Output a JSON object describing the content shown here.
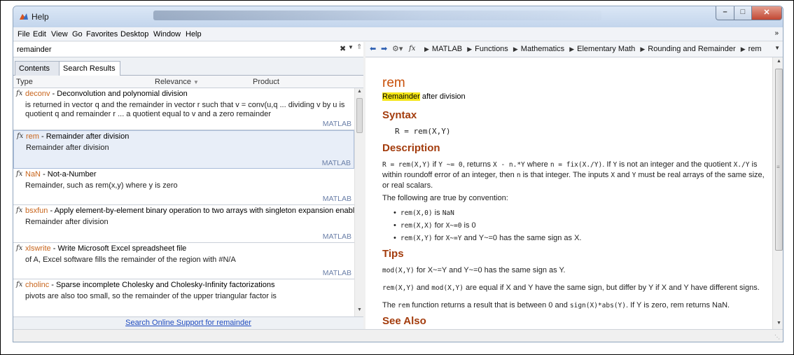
{
  "window": {
    "title": "Help"
  },
  "menu": [
    "File",
    "Edit",
    "View",
    "Go",
    "Favorites",
    "Desktop",
    "Window",
    "Help"
  ],
  "search": {
    "value": "remainder"
  },
  "tabs": [
    "Contents",
    "Search Results"
  ],
  "columns": {
    "type": "Type",
    "relevance": "Relevance",
    "product": "Product"
  },
  "results": [
    {
      "name": "deconv",
      "desc": " - Deconvolution and polynomial division",
      "snippet": "is returned in vector q and the remainder in vector r such that v = conv(u,q ... dividing v by u is quotient q and remainder r ... a quotient equal to v and a zero remainder",
      "product": "MATLAB"
    },
    {
      "name": "rem",
      "desc": " - Remainder after division",
      "snippet": "Remainder after division",
      "product": "MATLAB"
    },
    {
      "name": "NaN",
      "desc": " - Not-a-Number",
      "snippet": "Remainder, such as rem(x,y) where y is zero",
      "product": "MATLAB"
    },
    {
      "name": "bsxfun",
      "desc": " - Apply element-by-element binary operation to two arrays with singleton expansion enabled",
      "snippet": "Remainder after division",
      "product": "MATLAB"
    },
    {
      "name": "xlswrite",
      "desc": " - Write Microsoft Excel spreadsheet file",
      "snippet": "of A, Excel software fills the remainder of the region with #N/A",
      "product": "MATLAB"
    },
    {
      "name": "cholinc",
      "desc": " - Sparse incomplete Cholesky and Cholesky-Infinity factorizations",
      "snippet": "pivots are also too small, so the remainder of the upper triangular factor is",
      "product": ""
    }
  ],
  "online_link": "Search Online Support for remainder",
  "breadcrumb": [
    "MATLAB",
    "Functions",
    "Mathematics",
    "Elementary Math",
    "Rounding and Remainder",
    "rem"
  ],
  "doc": {
    "fname": "rem",
    "purpose_hl": "Remainder",
    "purpose_rest": " after division",
    "syntax_heading": "Syntax",
    "syntax": "R = rem(X,Y)",
    "description_heading": "Description",
    "desc_code1": "R = rem(X,Y)",
    "desc_t1": " if ",
    "desc_code2": "Y ~= 0",
    "desc_t2": ", returns ",
    "desc_code3": "X - n.*Y",
    "desc_t3": " where ",
    "desc_code4": "n = fix(X./Y)",
    "desc_t4": ". If ",
    "desc_code5": "Y",
    "desc_t5": " is not an integer and the quotient ",
    "desc_code6": "X./Y",
    "desc_t6": " is within roundoff error of an integer, then ",
    "desc_code7": "n",
    "desc_t7": " is that integer. The inputs ",
    "desc_code8": "X",
    "desc_t8": " and ",
    "desc_code9": "Y",
    "desc_t9": " must be real arrays of the same size, or real scalars.",
    "convention": "The following are true by convention:",
    "bullets": [
      {
        "code": "rem(X,0)",
        "mid": " is ",
        "code2": "NaN",
        "rest": ""
      },
      {
        "code": "rem(X,X)",
        "mid": " for ",
        "code2": "X~=0",
        "rest": " is 0"
      },
      {
        "code": "rem(X,Y)",
        "mid": " for ",
        "code2": "X~=Y",
        "rest": " and Y~=0 has the same sign as X."
      }
    ],
    "tips_heading": "Tips",
    "tip1_code": "mod(X,Y)",
    "tip1_rest": " for X~=Y and Y~=0 has the same sign as Y.",
    "tip2_code": "rem(X,Y)",
    "tip2_mid": " and ",
    "tip2_code2": "mod(X,Y)",
    "tip2_rest": " are equal if X and Y have the same sign, but differ by Y if X and Y have different signs.",
    "tip3_pre": "The ",
    "tip3_code": "rem",
    "tip3_mid": " function returns a result that is between 0 and ",
    "tip3_code2": "sign(X)*abs(Y)",
    "tip3_rest": ". If Y is zero, rem returns NaN.",
    "seealso_heading": "See Also"
  }
}
